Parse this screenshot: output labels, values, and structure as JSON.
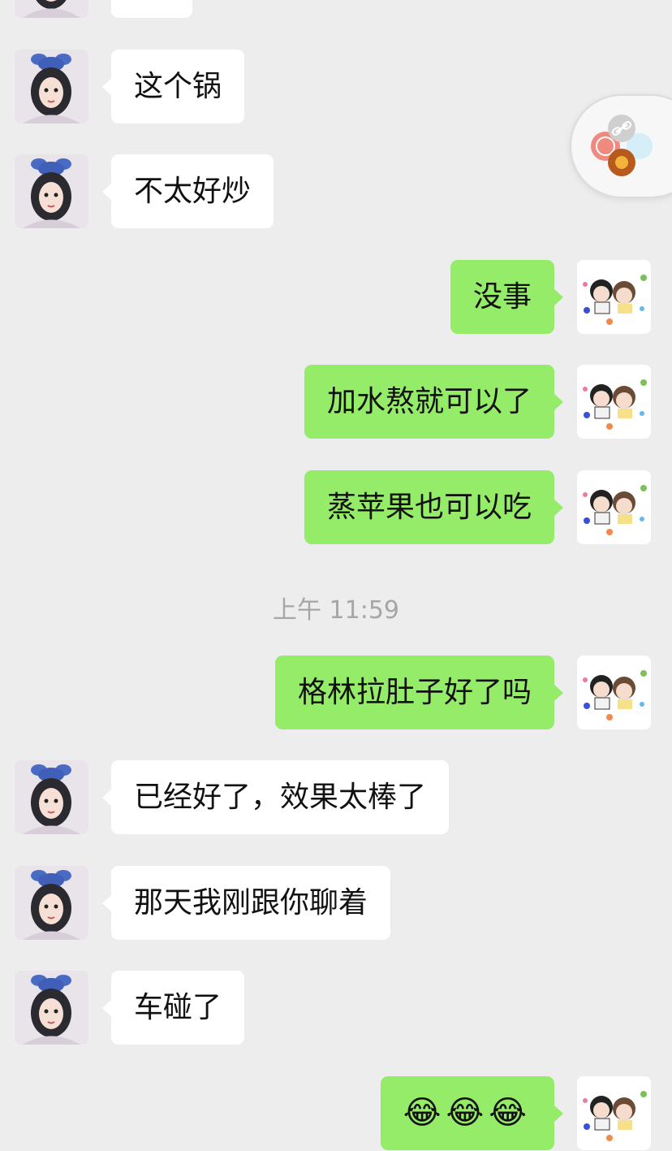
{
  "messages": [
    {
      "direction": "in",
      "text": ""
    },
    {
      "direction": "in",
      "text": "这个锅"
    },
    {
      "direction": "in",
      "text": "不太好炒"
    },
    {
      "direction": "out",
      "text": "没事"
    },
    {
      "direction": "out",
      "text": "加水熬就可以了"
    },
    {
      "direction": "out",
      "text": "蒸苹果也可以吃"
    },
    {
      "direction": "out",
      "text": "格林拉肚子好了吗"
    },
    {
      "direction": "in",
      "text": "已经好了，效果太棒了"
    },
    {
      "direction": "in",
      "text": "那天我刚跟你聊着"
    },
    {
      "direction": "in",
      "text": "车碰了"
    },
    {
      "direction": "out",
      "text": "😂😂😂"
    }
  ],
  "timestamp": "上午 11:59",
  "floating_widget": {
    "icon": "link-icon"
  },
  "colors": {
    "background": "#ededed",
    "incoming_bubble": "#ffffff",
    "outgoing_bubble": "#95ec69",
    "timestamp_text": "#a6a6a6"
  }
}
